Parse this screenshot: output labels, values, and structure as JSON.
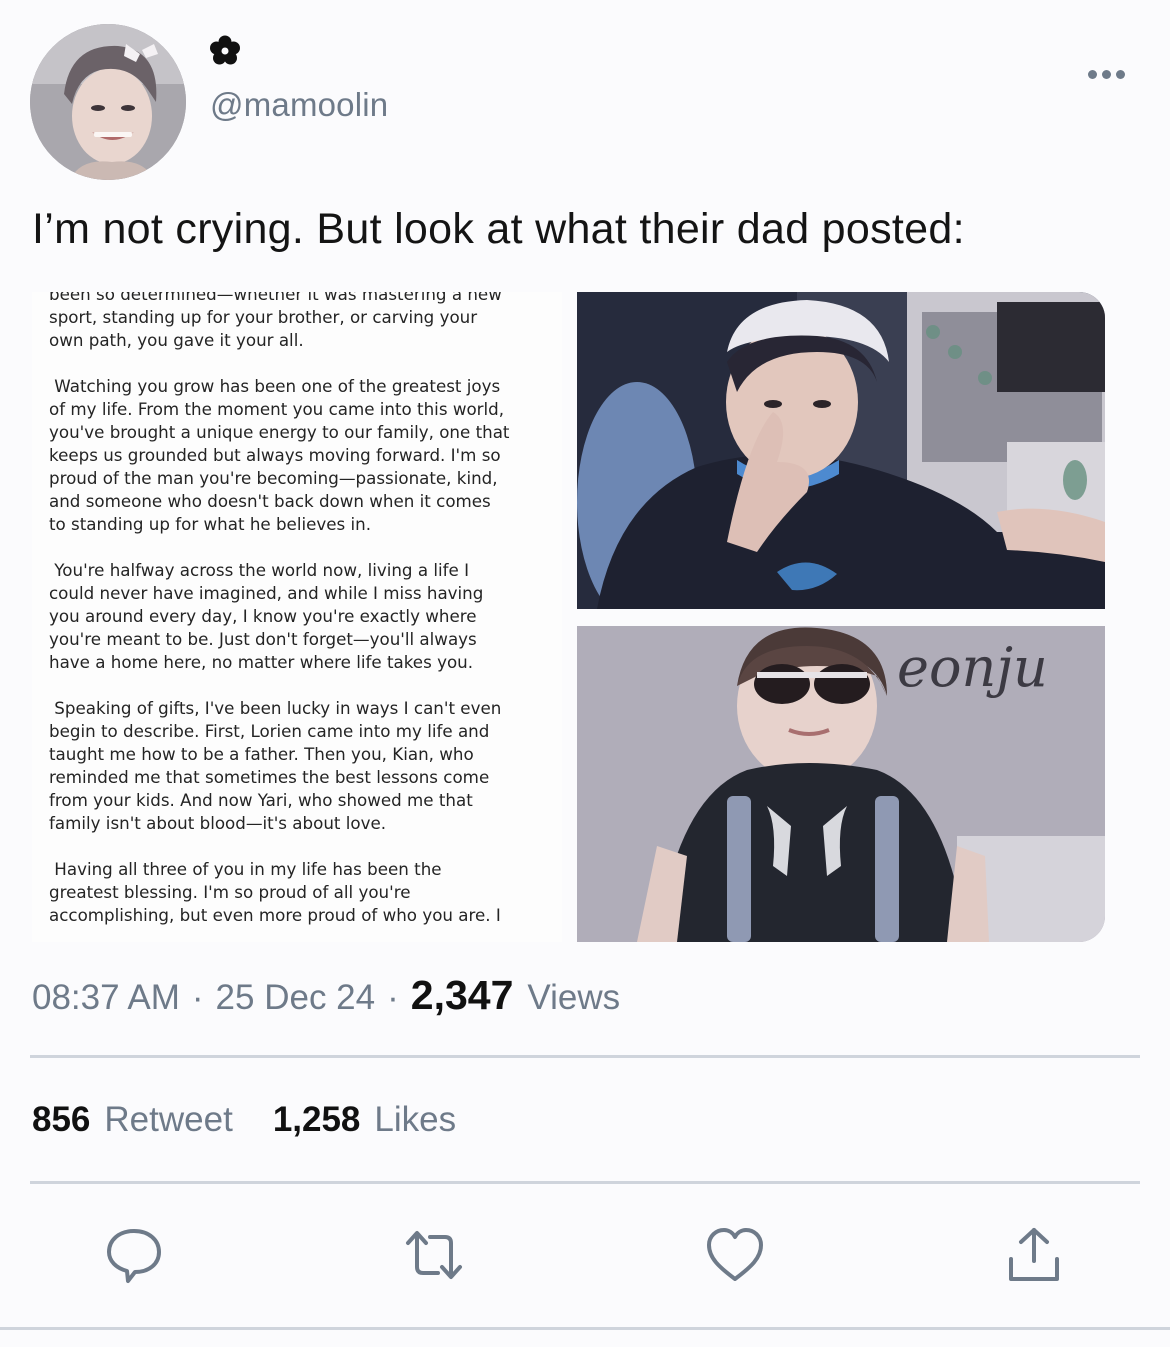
{
  "user": {
    "display_name_icon": "flower-icon",
    "handle": "@mamoolin"
  },
  "tweet": {
    "text": "I’m not crying. But look at what their dad posted:",
    "letter_paragraphs": [
      "been so determined—whether it was mastering a new\nsport, standing up for your brother, or carving your\nown path, you gave it your all.",
      " Watching you grow has been one of the greatest joys\nof my life. From the moment you came into this world,\nyou've brought a unique energy to our family, one that\nkeeps us grounded but always moving forward. I'm so\nproud of the man you're becoming—passionate, kind,\nand someone who doesn't back down when it comes\nto standing up for what he believes in.",
      " You're halfway across the world now, living a life I\ncould never have imagined, and while I miss having\nyou around every day, I know you're exactly where\nyou're meant to be. Just don't forget—you'll always\nhave a home here, no matter where life takes you.",
      " Speaking of gifts, I've been lucky in ways I can't even\nbegin to describe. First, Lorien came into my life and\ntaught me how to be a father. Then you, Kian, who\nreminded me that sometimes the best lessons come\nfrom your kids. And now Yari, who showed me that\nfamily isn't about blood—it's about love.",
      " Having all three of you in my life has been the\ngreatest blessing. I'm so proud of all you're\naccomplishing, but even more proud of who you are. I"
    ],
    "photo_watermark": "eonju",
    "time": "08:37 AM",
    "date": "25 Dec 24",
    "separator": "·",
    "views_count": "2,347",
    "views_label": "Views",
    "retweet_count": "856",
    "retweet_label": "Retweet",
    "likes_count": "1,258",
    "likes_label": "Likes"
  },
  "icons": {
    "more": "more-horizontal-icon",
    "reply": "reply-icon",
    "retweet": "retweet-icon",
    "like": "heart-icon",
    "share": "share-icon"
  },
  "colors": {
    "secondary_text": "#6e7a89",
    "divider": "#cfd4dc",
    "icon": "#6e7a89"
  }
}
